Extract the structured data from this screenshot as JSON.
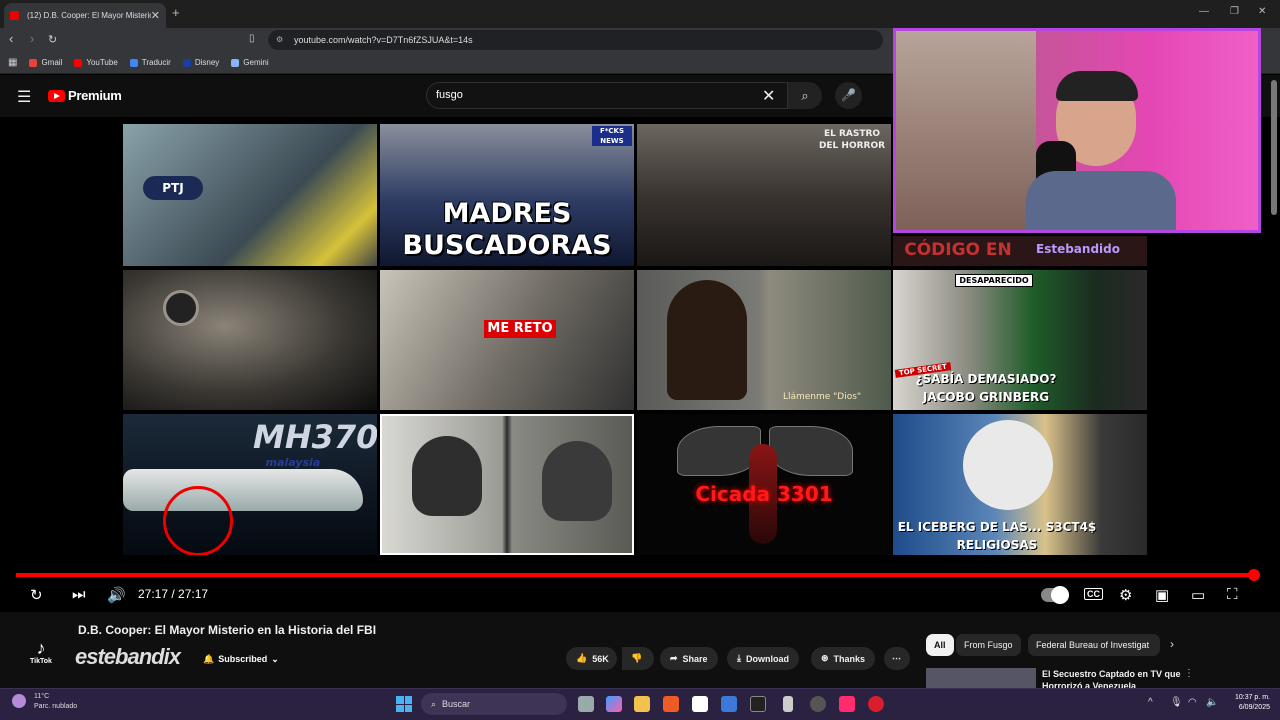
{
  "browser": {
    "tab_title": "(12) D.B. Cooper: El Mayor Misterio",
    "url": "youtube.com/watch?v=D7Tn6fZSJUA&t=14s",
    "bookmarks": [
      {
        "label": "Gmail",
        "color": "#ea4335"
      },
      {
        "label": "YouTube",
        "color": "#ff0000"
      },
      {
        "label": "Traducir",
        "color": "#4285f4"
      },
      {
        "label": "Disney",
        "color": "#1a3fa0"
      },
      {
        "label": "Gemini",
        "color": "#8ab4f8"
      }
    ]
  },
  "youtube": {
    "logo_label": "Premium",
    "search_value": "fusgo"
  },
  "endscreen": {
    "tiles": [
      {
        "text": "PTJ",
        "bg": "#6a7b84"
      },
      {
        "text": "MADRES BUSCADORAS",
        "bg": "#2d3b63",
        "badge": "F*CKS NEWS"
      },
      {
        "text": "EL RASTRO DEL HORROR",
        "bg": "#3a3430"
      },
      {
        "text": "CÓDIGO EN",
        "bg": "#5a2424",
        "extra": "Estebandido"
      },
      {
        "text": "",
        "bg": "#1a1c1d"
      },
      {
        "text": "ME RETO",
        "bg": "#6e6a63"
      },
      {
        "text": "Llámenme \"Dios\"",
        "bg": "#5f5f5a"
      },
      {
        "text": "¿SABÍA DEMASIADO? JACOBO GRINBERG",
        "bg": "#2a4e30",
        "badge": "DESAPARECIDO",
        "badge2": "TOP SECRET"
      },
      {
        "text": "MH370",
        "bg": "#1b2a3a",
        "extra": "malaysia"
      },
      {
        "text": "",
        "bg": "#8a8a85"
      },
      {
        "text": "Cicada 3301",
        "bg": "#050505"
      },
      {
        "text": "EL ICEBERG DE LAS... S3CT4$ RELIGIOSAS",
        "bg": "#2f5a86"
      }
    ]
  },
  "player": {
    "time": "27:17 / 27:17",
    "progress": 1.0
  },
  "video": {
    "title": "D.B. Cooper: El Mayor Misterio en la Historia del FBI",
    "channel": "estebandix",
    "platform_label": "TikTok",
    "subscribed_label": "Subscribed",
    "likes": "56K",
    "share_label": "Share",
    "download_label": "Download",
    "thanks_label": "Thanks"
  },
  "sidebar": {
    "chips": [
      "All",
      "From Fusgo",
      "Federal Bureau of Investigat"
    ],
    "recommendation_title": "El Secuestro Captado en TV que Horrorizó a Venezuela"
  },
  "taskbar": {
    "weather_temp": "11°C",
    "weather_desc": "Parc. nublado",
    "search_placeholder": "Buscar",
    "time": "10:37 p. m.",
    "date": "6/09/2025"
  }
}
